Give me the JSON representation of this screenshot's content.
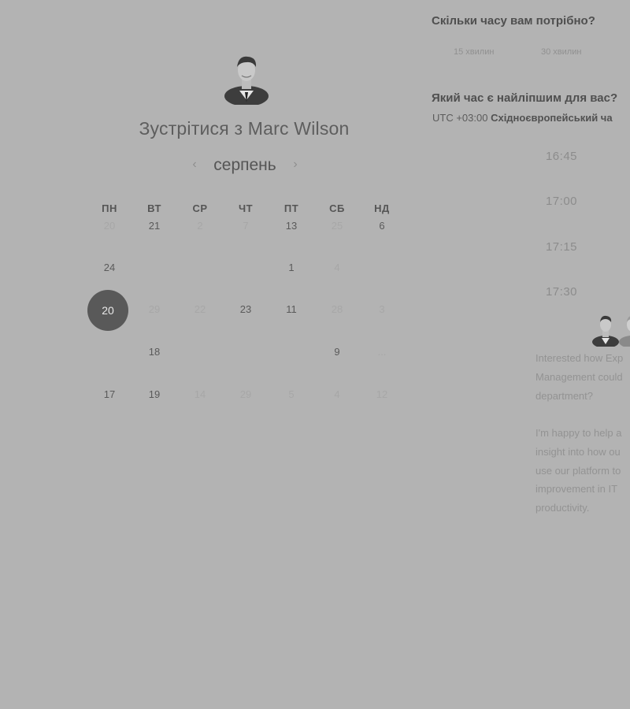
{
  "header": {
    "title": "Зустрітися з Marc Wilson"
  },
  "calendar": {
    "month": "серпень",
    "prev_icon": "chevron-left-icon",
    "next_icon": "chevron-right-icon",
    "weekdays": [
      "ПН",
      "ВТ",
      "СР",
      "ЧТ",
      "ПТ",
      "СБ",
      "НД"
    ],
    "weeks": [
      [
        "20",
        "21",
        "2",
        "7",
        "13",
        "25",
        "6"
      ],
      [
        "24",
        "",
        "",
        "",
        "1",
        "4",
        ""
      ],
      [
        "20",
        "29",
        "22",
        "23",
        "11",
        "28",
        "3"
      ],
      [
        "",
        "18",
        "",
        "",
        "",
        "9",
        "..."
      ],
      [
        "17",
        "19",
        "14",
        "29",
        "5",
        "4",
        "12"
      ]
    ],
    "selected": "20"
  },
  "duration": {
    "question": "Скільки часу вам потрібно?",
    "options": [
      "15 хвилин",
      "30 хвилин"
    ]
  },
  "time": {
    "question": "Який час є найліпшим для вас?",
    "tz_offset": "UTC +03:00",
    "tz_name": "Східноєвропейський ча",
    "slots": [
      "16:45",
      "17:00",
      "17:15",
      "17:30"
    ]
  },
  "description": {
    "para1": [
      "Interested how Exp",
      "Management could",
      "department?"
    ],
    "para2": [
      "I'm happy to help a",
      "insight into how ou",
      "use our platform to",
      "improvement in IT",
      "productivity."
    ]
  },
  "colors": {
    "background": "#b3b3b3",
    "selected_day": "#595959"
  }
}
